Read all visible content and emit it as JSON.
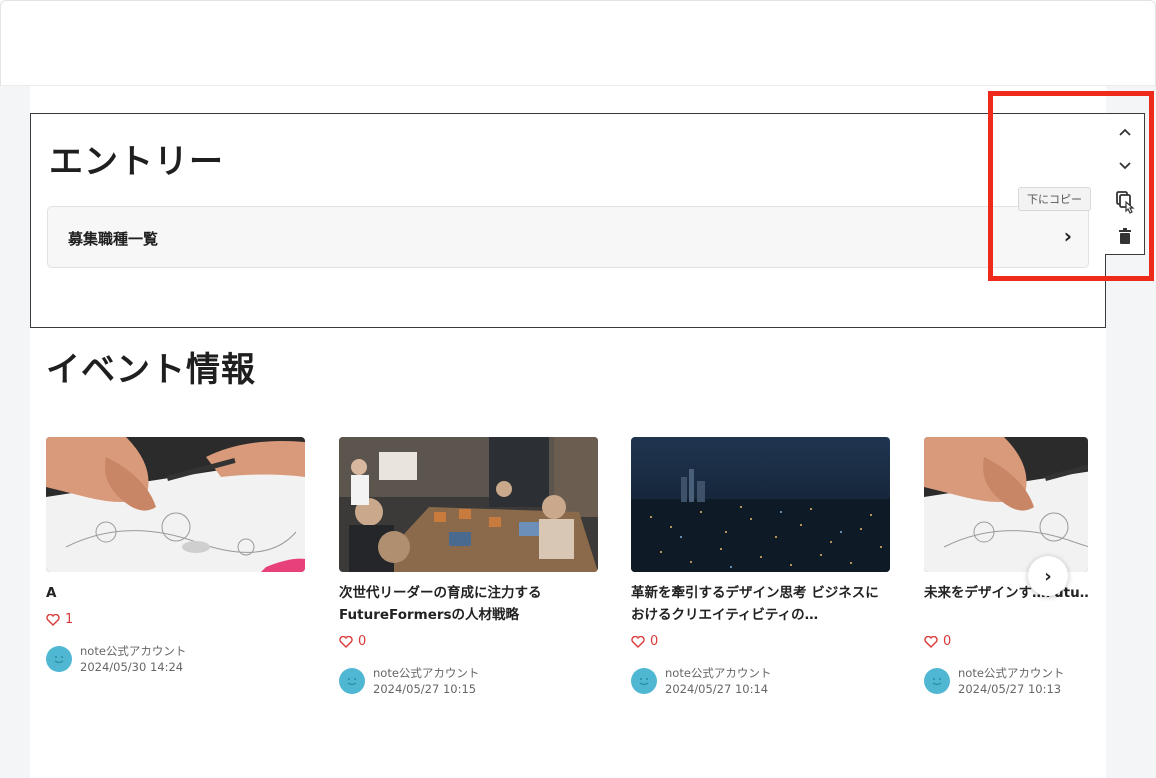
{
  "entry": {
    "title": "エントリー",
    "menu_label": "募集職種一覧",
    "menu_chevron": "›"
  },
  "toolbar": {
    "move_up": "move-up",
    "move_down": "move-down",
    "copy_below_tooltip": "下にコピー",
    "delete": "delete"
  },
  "events": {
    "title": "イベント情報",
    "cards": [
      {
        "title": "A",
        "likes": "1",
        "author": "note公式アカウント",
        "date": "2024/05/30 14:24",
        "thumb": "sketch"
      },
      {
        "title": "次世代リーダーの育成に注力するFutureFormersの人材戦略",
        "likes": "0",
        "author": "note公式アカウント",
        "date": "2024/05/27 10:15",
        "thumb": "meeting"
      },
      {
        "title": "革新を牽引するデザイン思考 ビジネスにおけるクリエイティビティの…",
        "likes": "0",
        "author": "note公式アカウント",
        "date": "2024/05/27 10:14",
        "thumb": "city"
      },
      {
        "title": "未来をデザインす…Futu…の新時代への挑戦",
        "likes": "0",
        "author": "note公式アカウント",
        "date": "2024/05/27 10:13",
        "thumb": "sketch"
      }
    ],
    "next_label": "›"
  },
  "colors": {
    "highlight": "#ee2a1b",
    "avatar": "#4fb7d2",
    "like": "#d93a3a"
  }
}
